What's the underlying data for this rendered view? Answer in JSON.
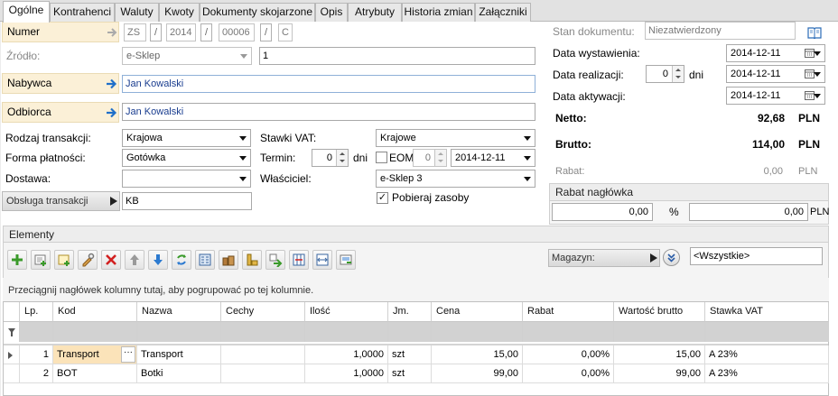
{
  "tabs": [
    "Ogólne",
    "Kontrahenci",
    "Waluty",
    "Kwoty",
    "Dokumenty skojarzone",
    "Opis",
    "Atrybuty",
    "Historia zmian",
    "Załączniki"
  ],
  "header": {
    "numer_label": "Numer",
    "numer_parts": [
      "ZS",
      "/",
      "2014",
      "/",
      "00006",
      "/",
      "C"
    ],
    "zrodlo_label": "Źródło:",
    "zrodlo_value": "e-Sklep",
    "zrodlo_number": "1",
    "nabywca_label": "Nabywca",
    "nabywca_value": "Jan Kowalski",
    "odbiorca_label": "Odbiorca",
    "odbiorca_value": "Jan Kowalski"
  },
  "status": {
    "stan_label": "Stan dokumentu:",
    "stan_value": "Niezatwierdzony",
    "data_wystawienia_label": "Data wystawienia:",
    "data_wystawienia": "2014-12-11",
    "data_realizacji_label": "Data realizacji:",
    "dni_value": "0",
    "dni_label": "dni",
    "data_realizacji": "2014-12-11",
    "data_aktywacji_label": "Data aktywacji:",
    "data_aktywacji": "2014-12-11"
  },
  "totals": {
    "netto_label": "Netto:",
    "netto_value": "92,68",
    "brutto_label": "Brutto:",
    "brutto_value": "114,00",
    "rabat_label": "Rabat:",
    "rabat_value": "0,00",
    "currency": "PLN",
    "rabat_naglowka_label": "Rabat nagłówka",
    "rabat_percent": "0,00",
    "percent_sign": "%",
    "rabat_amount": "0,00"
  },
  "transaction": {
    "rodzaj_label": "Rodzaj transakcji:",
    "rodzaj_value": "Krajowa",
    "forma_label": "Forma płatności:",
    "forma_value": "Gotówka",
    "dostawa_label": "Dostawa:",
    "dostawa_value": "",
    "obsluga_label": "Obsługa transakcji",
    "obsluga_value": "KB",
    "stawki_label": "Stawki VAT:",
    "stawki_value": "Krajowe",
    "termin_label": "Termin:",
    "termin_value": "0",
    "termin_dni": "dni",
    "eom_label": "EOM",
    "eom_value": "0",
    "termin_date": "2014-12-11",
    "wlasciciel_label": "Właściciel:",
    "wlasciciel_value": "e-Sklep 3",
    "pobieraj_label": "Pobieraj zasoby",
    "pobieraj_checked": "✓"
  },
  "elements": {
    "section_label": "Elementy",
    "magazyn_label": "Magazyn:",
    "magazyn_value": "<Wszystkie>",
    "group_hint": "Przeciągnij nagłówek kolumny tutaj, aby pogrupować po tej kolumnie.",
    "columns": [
      "Lp.",
      "Kod",
      "Nazwa",
      "Cechy",
      "Ilość",
      "Jm.",
      "Cena",
      "Rabat",
      "Wartość brutto",
      "Stawka VAT"
    ],
    "rows": [
      {
        "lp": "1",
        "kod": "Transport",
        "nazwa": "Transport",
        "cechy": "",
        "ilosc": "1,0000",
        "jm": "szt",
        "cena": "15,00",
        "rabat": "0,00%",
        "wartosc": "15,00",
        "vat": "A 23%"
      },
      {
        "lp": "2",
        "kod": "BOT",
        "nazwa": "Botki",
        "cechy": "",
        "ilosc": "1,0000",
        "jm": "szt",
        "cena": "99,00",
        "rabat": "0,00%",
        "wartosc": "99,00",
        "vat": "A 23%"
      }
    ],
    "toolbar_icons": [
      "add-icon",
      "add-from-list-icon",
      "add-multiple-icon",
      "edit-icon",
      "delete-icon",
      "move-up-icon",
      "move-down-icon",
      "refresh-icon",
      "calculator-icon",
      "stock-icon",
      "stack-icon",
      "split-icon",
      "columns-icon",
      "fit-icon",
      "export-icon"
    ]
  },
  "colors": {
    "accent_label": "#fbf0d7",
    "blue_arrow": "#1f6fc9",
    "name_text": "#1a3d8f",
    "selected_cell": "#fbe3b9"
  }
}
